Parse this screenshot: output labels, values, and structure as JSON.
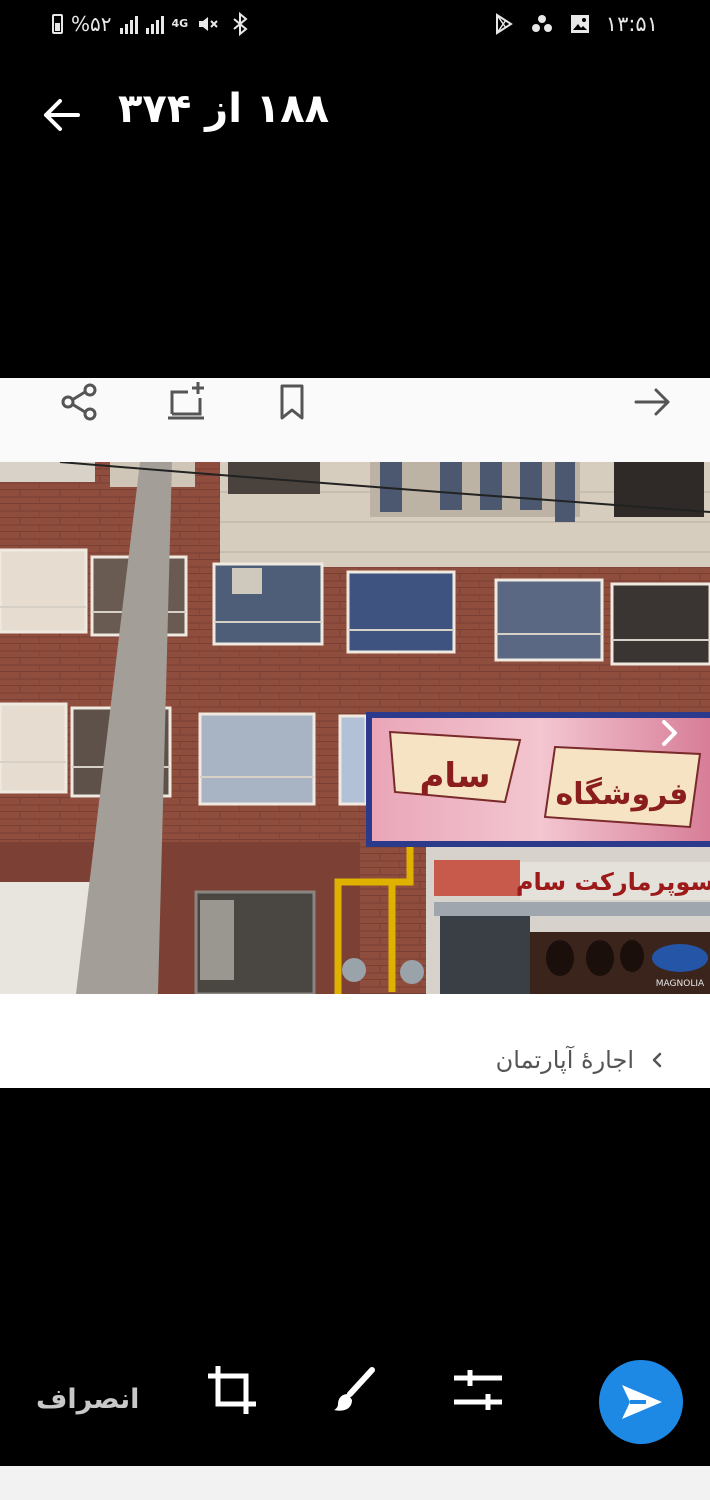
{
  "status_bar": {
    "battery_percent": "%۵۲",
    "network": "4G",
    "time": "۱۳:۵۱",
    "icons": [
      "battery-icon",
      "signal-icon",
      "signal-icon",
      "4g-icon",
      "mute-icon",
      "bluetooth-icon",
      "play-store-icon",
      "game-icon",
      "gallery-icon"
    ]
  },
  "header": {
    "back_icon": "arrow-left-icon",
    "title": "۱۸۸ از ۳۷۴"
  },
  "card": {
    "toolbar_icons": [
      "share-icon",
      "add-to-screen-icon",
      "bookmark-icon",
      "forward-arrow-icon"
    ],
    "photo": {
      "description_icon": "building-photo",
      "sign_main": "فروشگاه سام",
      "sign_secondary": "سوپرمارکت سام",
      "sign_brand": "MAGNOLIA"
    },
    "next_icon": "chevron-right-icon",
    "caption": "اجارهٔ آپارتمان"
  },
  "bottom_bar": {
    "cancel_label": "انصراف",
    "icons": [
      "crop-icon",
      "brush-icon",
      "adjust-icon"
    ],
    "send_icon": "send-icon"
  },
  "colors": {
    "background": "#000000",
    "card": "#ffffff",
    "send_button": "#1e88e5"
  }
}
